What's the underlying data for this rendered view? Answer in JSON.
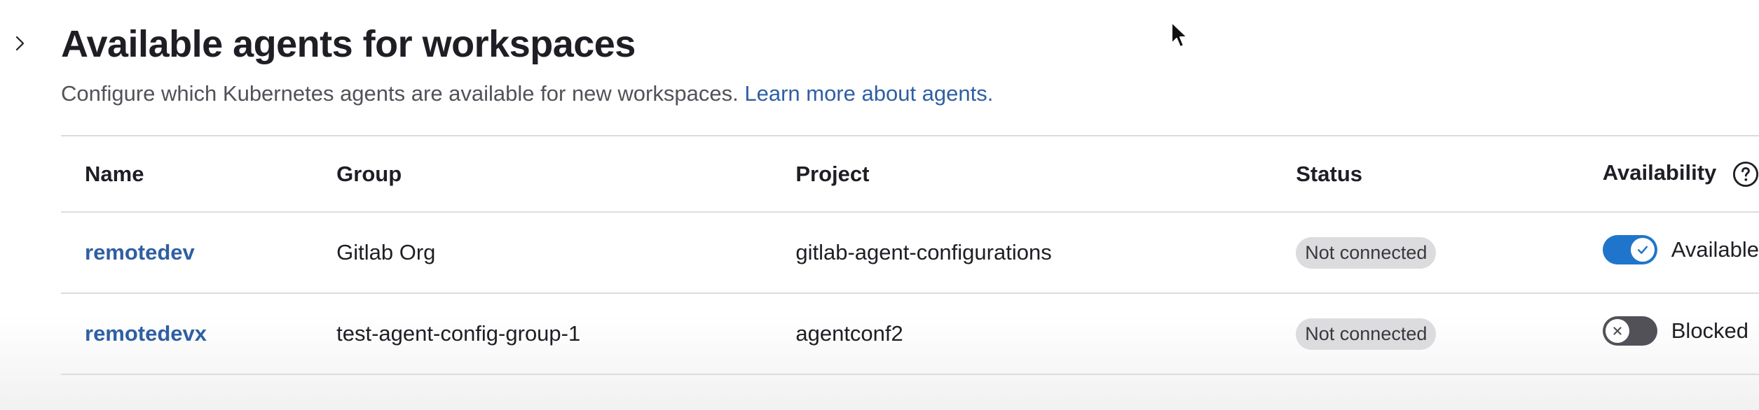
{
  "section": {
    "title": "Available agents for workspaces",
    "description": "Configure which Kubernetes agents are available for new workspaces.",
    "learn_more_link": "Learn more about agents."
  },
  "table": {
    "headers": {
      "name": "Name",
      "group": "Group",
      "project": "Project",
      "status": "Status",
      "availability": "Availability"
    },
    "rows": [
      {
        "name": "remotedev",
        "group": "Gitlab Org",
        "project": "gitlab-agent-configurations",
        "status": "Not connected",
        "availability": "Available",
        "availability_on": true
      },
      {
        "name": "remotedevx",
        "group": "test-agent-config-group-1",
        "project": "agentconf2",
        "status": "Not connected",
        "availability": "Blocked",
        "availability_on": false
      }
    ]
  },
  "icons": {
    "expand": "chevron-right-icon",
    "help": "question-circle-icon",
    "toggle_on": "check-icon",
    "toggle_off": "close-icon",
    "pointer": "mouse-cursor-icon"
  },
  "colors": {
    "link": "#2f5fa3",
    "toggle_on": "#1f75cb",
    "toggle_off": "#535158",
    "badge_bg": "#dcdcde"
  }
}
